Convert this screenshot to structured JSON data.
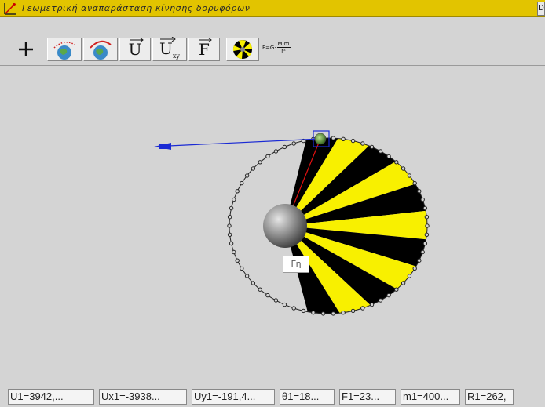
{
  "window": {
    "title": "Γεωμετρική αναπαράσταση κίνησης δορυφόρων",
    "title_button": "D"
  },
  "toolbar": {
    "buttons": [
      {
        "name": "add-button",
        "label": "+"
      },
      {
        "name": "orbit-path-button",
        "icon": "earth-dotted-orbit-icon"
      },
      {
        "name": "orbit-arc-button",
        "icon": "earth-arc-orbit-icon"
      },
      {
        "name": "velocity-vector-button",
        "label": "U"
      },
      {
        "name": "velocity-components-button",
        "label": "U",
        "subscript": "xy"
      },
      {
        "name": "force-vector-button",
        "label": "F"
      },
      {
        "name": "kepler-areas-button",
        "icon": "kepler-sectors-icon"
      }
    ],
    "formula": {
      "prefix": "F=G·",
      "numerator": "M·m",
      "denominator": "r²"
    }
  },
  "scene": {
    "earth_label": "Γη",
    "colors": {
      "sector_yellow": "#f8f000",
      "sector_black": "#000000",
      "vector": "#1a2ad4",
      "radius": "#e01010",
      "orbit": "#222222"
    }
  },
  "status": {
    "fields": [
      "U1=3942,...",
      "Ux1=-3938...",
      "Uy1=-191,4...",
      "θ1=18...",
      "F1=23...",
      "m1=400...",
      "R1=262,"
    ]
  }
}
